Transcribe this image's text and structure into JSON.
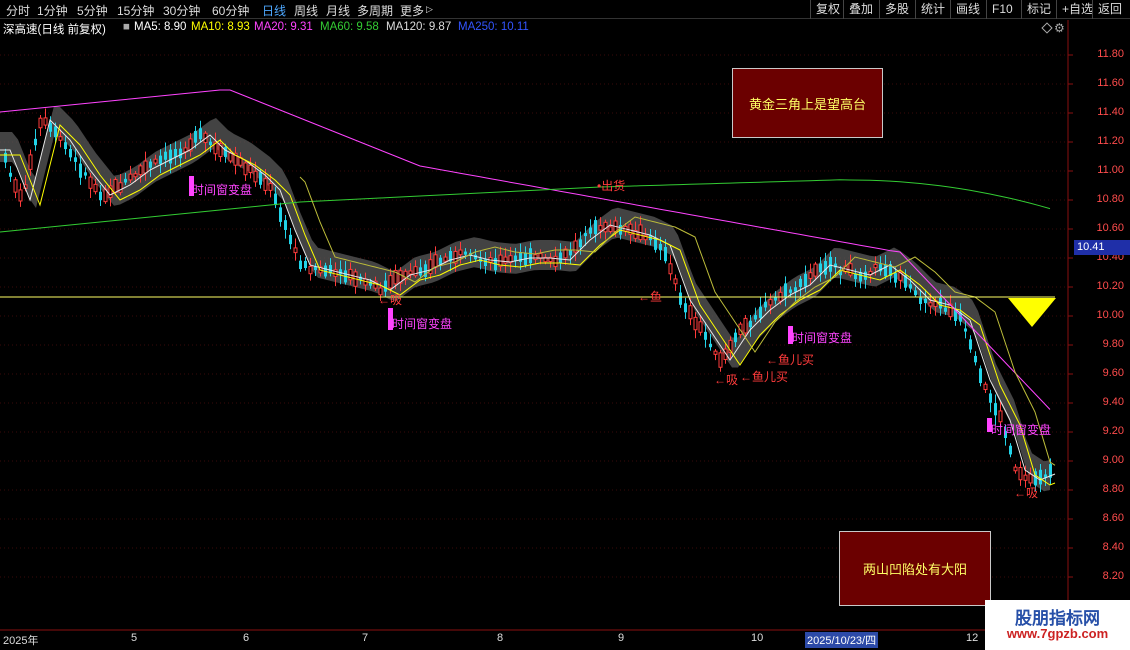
{
  "toolbar": {
    "timeframes": [
      "分时",
      "1分钟",
      "5分钟",
      "15分钟",
      "30分钟",
      "60分钟",
      "日线",
      "周线",
      "月线",
      "多周期",
      "更多"
    ],
    "more_arrow": "▷",
    "active": "日线",
    "right_buttons": [
      "复权",
      "叠加",
      "多股",
      "统计",
      "画线",
      "F10",
      "标记",
      "+自选",
      "返回"
    ]
  },
  "ma_bar": {
    "title": "深高速(日线 前复权)",
    "items": [
      {
        "label": "MA5: 8.90",
        "color": "#ffffff"
      },
      {
        "label": "MA10: 8.93",
        "color": "#ffff00"
      },
      {
        "label": "MA20: 9.31",
        "color": "#ff44ff"
      },
      {
        "label": "MA60: 9.58",
        "color": "#33cc33"
      },
      {
        "label": "MA120: 9.87",
        "color": "#dddddd"
      },
      {
        "label": "MA250: 10.11",
        "color": "#3355ff"
      }
    ]
  },
  "y_axis": [
    "11.80",
    "11.60",
    "11.40",
    "11.20",
    "11.00",
    "10.80",
    "10.60",
    "10.40",
    "10.20",
    "10.00",
    "9.80",
    "9.60",
    "9.40",
    "9.20",
    "9.00",
    "8.80",
    "8.60",
    "8.40",
    "8.20"
  ],
  "current_price": "10.41",
  "x_axis": [
    "2025年",
    "5",
    "6",
    "7",
    "8",
    "9",
    "10",
    "2025/10/23/四",
    "12"
  ],
  "signals": [
    {
      "text": "•出货",
      "kind": "r"
    },
    {
      "text": "时间窗变盘",
      "kind": "m"
    },
    {
      "text": "时间窗变盘",
      "kind": "m"
    },
    {
      "text": "时间窗变盘",
      "kind": "m"
    },
    {
      "text": "时间窗变盘",
      "kind": "m"
    },
    {
      "text": "←吸",
      "kind": "r"
    },
    {
      "text": "←吸",
      "kind": "r"
    },
    {
      "text": "←吸",
      "kind": "r"
    },
    {
      "text": "←鱼儿买",
      "kind": "r"
    },
    {
      "text": "←鱼儿买",
      "kind": "r"
    },
    {
      "text": "←鱼",
      "kind": "r"
    }
  ],
  "notes": {
    "golden_triangle": "黄金三角上是望高台",
    "two_mountains": "两山凹陷处有大阳"
  },
  "watermark": {
    "line1": "股朋指标网",
    "line2": "www.7gpzb.com"
  },
  "colors": {
    "up": "#22d3e8",
    "down": "#ff3b3b",
    "ma5": "#ffffff",
    "ma10": "#ffff00",
    "ma20": "#ff44ff",
    "ma60": "#33cc33",
    "baseline": "#ffff66",
    "band": "#555555"
  }
}
